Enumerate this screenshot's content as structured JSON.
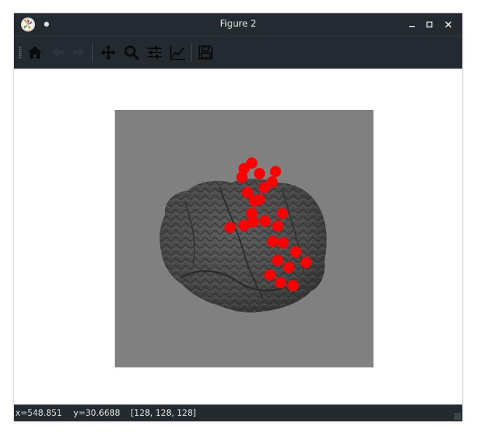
{
  "window": {
    "title": "Figure 2",
    "app_icon": "matplotlib-logo-icon",
    "controls": [
      "minimize-icon",
      "maximize-icon",
      "close-icon"
    ]
  },
  "toolbar": {
    "buttons": [
      {
        "name": "home-button",
        "icon": "home-icon",
        "enabled": true
      },
      {
        "name": "back-button",
        "icon": "arrow-left-icon",
        "enabled": false
      },
      {
        "name": "forward-button",
        "icon": "arrow-right-icon",
        "enabled": false
      },
      {
        "name": "pan-button",
        "icon": "move-icon",
        "enabled": true
      },
      {
        "name": "zoom-button",
        "icon": "magnifier-icon",
        "enabled": true
      },
      {
        "name": "subplots-button",
        "icon": "sliders-icon",
        "enabled": true
      },
      {
        "name": "customize-button",
        "icon": "line-chart-icon",
        "enabled": true
      },
      {
        "name": "save-button",
        "icon": "floppy-disk-icon",
        "enabled": true
      }
    ]
  },
  "figure": {
    "background": "#ffffff",
    "axes_background": "#808080",
    "brain_color": "#4a4a4a",
    "electrode_color": "#ff0000",
    "electrode_count": 26
  },
  "status": {
    "x": "x=548.851",
    "y": "y=30.6688",
    "pixel": "[128, 128, 128]"
  },
  "colors": {
    "chrome": "#232b30",
    "chrome_text": "#e3e6e8"
  }
}
